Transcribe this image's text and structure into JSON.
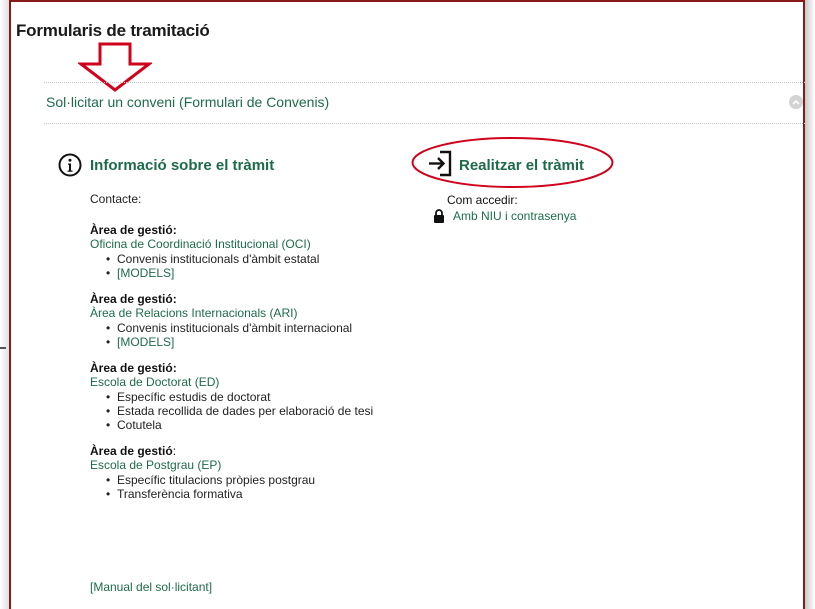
{
  "page": {
    "title": "Formularis de tramitació"
  },
  "accordion": {
    "title": "Sol·licitar un conveni (Formulari de Convenis)"
  },
  "info": {
    "heading": "Informació sobre el tràmit",
    "contact_label": "Contacte:",
    "areas": [
      {
        "label": "Àrea de gestió:",
        "office": "Oficina de Coordinació Institucional (OCI)",
        "items": [
          "Convenis institucionals d'àmbit estatal"
        ],
        "models": "[MODELS]"
      },
      {
        "label": "Àrea de gestió:",
        "office": "Àrea de Relacions Internacionals (ARI)",
        "items": [
          "Convenis institucionals d'àmbit internacional"
        ],
        "models": "[MODELS]"
      },
      {
        "label": "Àrea de gestió:",
        "office": "Escola de Doctorat (ED)",
        "items": [
          "Específic estudis de doctorat",
          "Estada recollida de dades per elaboració de tesi",
          "Cotutela"
        ]
      },
      {
        "label": "Àrea de gestió",
        "label_colon": ":",
        "office": "Escola de Postgrau (EP)",
        "items": [
          "Específic titulacions pròpies postgrau",
          "Transferència formativa"
        ]
      }
    ],
    "manual_link": "[Manual del sol·licitant]"
  },
  "procedure": {
    "heading": "Realitzar el tràmit",
    "access_label": "Com accedir:",
    "access_link": "Amb NIU i contrasenya"
  },
  "colors": {
    "accent": "#1e6b4a",
    "annotation_red": "#d0021b",
    "frame": "#8a1a1a"
  },
  "icons": {
    "info": "info-circle-icon",
    "enter": "sign-in-icon",
    "lock": "lock-icon",
    "collapse": "chevron-up-icon",
    "annotation_arrow": "red-down-arrow-icon"
  }
}
